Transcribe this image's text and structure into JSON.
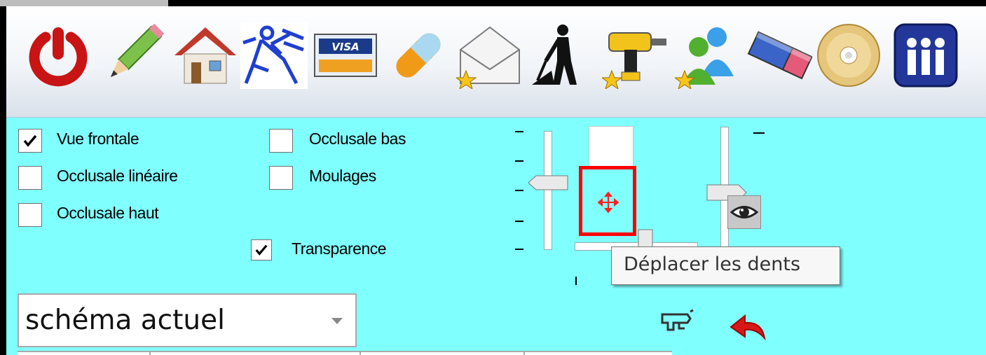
{
  "toolbar": {
    "icons": [
      "power-icon",
      "pencil-icon",
      "home-icon",
      "dental-diagram-icon",
      "visa-card-icon",
      "pill-icon",
      "mail-star-icon",
      "worker-shovel-icon",
      "drill-star-icon",
      "users-icon",
      "eraser-icon",
      "cd-icon",
      "people-icon"
    ]
  },
  "options": {
    "vue_frontale": {
      "label": "Vue frontale",
      "checked": true
    },
    "occlusale_lineaire": {
      "label": "Occlusale linéaire",
      "checked": false
    },
    "occlusale_haut": {
      "label": "Occlusale haut",
      "checked": false
    },
    "occlusale_bas": {
      "label": "Occlusale bas",
      "checked": false
    },
    "moulages": {
      "label": "Moulages",
      "checked": false
    },
    "transparence": {
      "label": "Transparence",
      "checked": true
    }
  },
  "tooltip": {
    "text": "Déplacer les dents"
  },
  "schema": {
    "selected": "schéma actuel"
  },
  "colors": {
    "background": "#80ffff",
    "highlight": "#ff0000",
    "power": "#cc1111"
  }
}
